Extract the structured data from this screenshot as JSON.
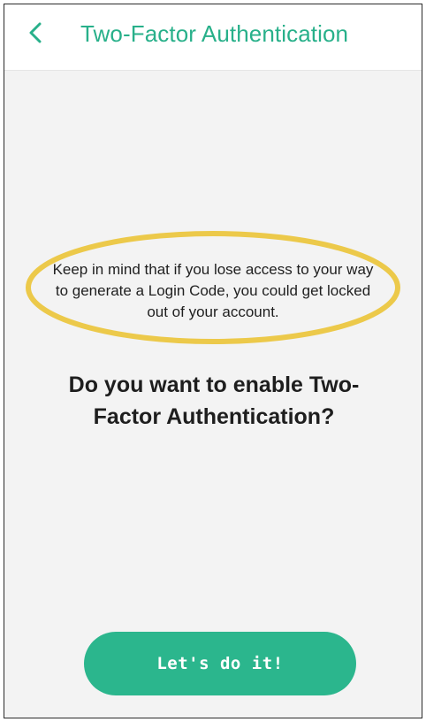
{
  "header": {
    "title": "Two-Factor Authentication",
    "back_icon": "chevron-left-icon"
  },
  "notice": {
    "text": "Keep in mind that if you lose access to your way to generate a Login Code, you could get locked out of your account.",
    "highlight_color": "#ecc94a"
  },
  "question": {
    "text": "Do you want to enable Two-Factor Authentication?"
  },
  "cta": {
    "label": "Let's do it!"
  },
  "colors": {
    "accent": "#28b08a",
    "button": "#2bb68d",
    "background": "#f3f3f3"
  }
}
